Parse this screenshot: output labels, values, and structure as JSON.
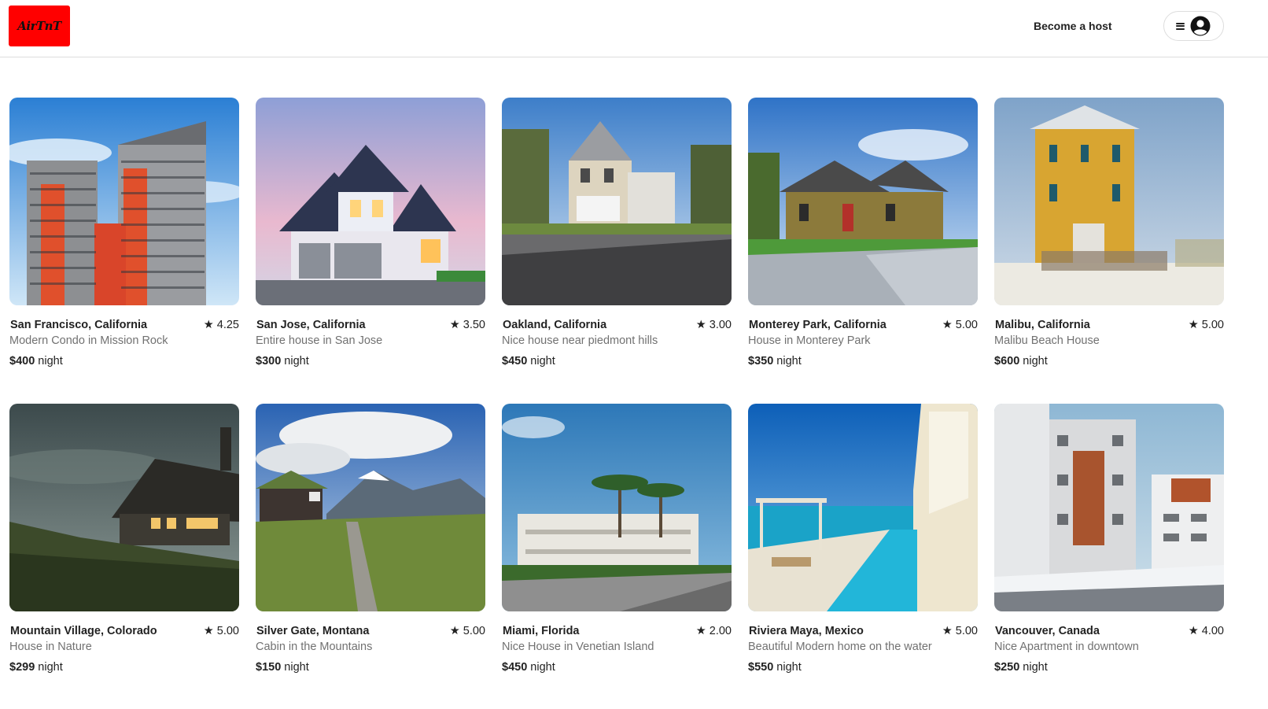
{
  "header": {
    "logo_text": "AirTnT",
    "become_host_label": "Become a host",
    "menu_icon": "hamburger-icon",
    "avatar_icon": "user-circle-icon"
  },
  "colors": {
    "brand": "#ff0000",
    "text": "#222222",
    "muted": "#717171",
    "border": "#dddddd"
  },
  "listings": [
    {
      "location": "San Francisco, California",
      "rating": "4.25",
      "description": "Modern Condo in Mission Rock",
      "price": "$400",
      "price_unit": "night"
    },
    {
      "location": "San Jose, California",
      "rating": "3.50",
      "description": "Entire house in San Jose",
      "price": "$300",
      "price_unit": "night"
    },
    {
      "location": "Oakland, California",
      "rating": "3.00",
      "description": "Nice house near piedmont hills",
      "price": "$450",
      "price_unit": "night"
    },
    {
      "location": "Monterey Park, California",
      "rating": "5.00",
      "description": "House in Monterey Park",
      "price": "$350",
      "price_unit": "night"
    },
    {
      "location": "Malibu, California",
      "rating": "5.00",
      "description": "Malibu Beach House",
      "price": "$600",
      "price_unit": "night"
    },
    {
      "location": "Mountain Village, Colorado",
      "rating": "5.00",
      "description": "House in Nature",
      "price": "$299",
      "price_unit": "night"
    },
    {
      "location": "Silver Gate, Montana",
      "rating": "5.00",
      "description": "Cabin in the Mountains",
      "price": "$150",
      "price_unit": "night"
    },
    {
      "location": "Miami, Florida",
      "rating": "2.00",
      "description": "Nice House in Venetian Island",
      "price": "$450",
      "price_unit": "night"
    },
    {
      "location": "Riviera Maya, Mexico",
      "rating": "5.00",
      "description": "Beautiful Modern home on the water",
      "price": "$550",
      "price_unit": "night"
    },
    {
      "location": "Vancouver, Canada",
      "rating": "4.00",
      "description": "Nice Apartment in downtown",
      "price": "$250",
      "price_unit": "night"
    }
  ],
  "rating_icon": "star-icon"
}
